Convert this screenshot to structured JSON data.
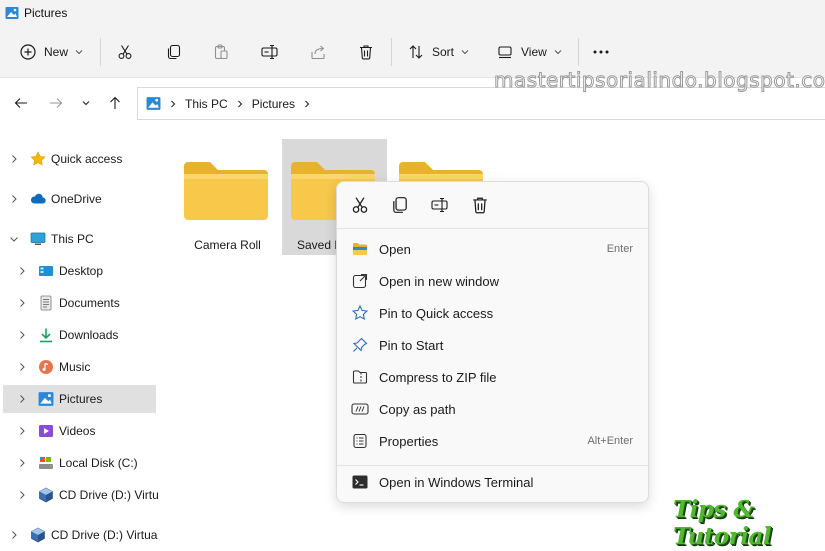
{
  "window": {
    "title": "Pictures",
    "icon": "pictures-icon"
  },
  "toolbar": {
    "new_label": "New",
    "sort_label": "Sort",
    "view_label": "View",
    "icons": [
      "new-icon",
      "cut-icon",
      "copy-icon",
      "paste-icon",
      "rename-icon",
      "share-icon",
      "delete-icon",
      "sort-icon",
      "view-icon",
      "more-icon"
    ]
  },
  "address": {
    "crumbs": [
      "This PC",
      "Pictures"
    ]
  },
  "watermark": "mastertipsorialindo.blogspot.com",
  "sidebar": {
    "items": [
      {
        "label": "Quick access",
        "icon": "star-icon",
        "expanded": false
      },
      {
        "label": "OneDrive",
        "icon": "cloud-icon",
        "expanded": false
      },
      {
        "label": "This PC",
        "icon": "monitor-icon",
        "expanded": true
      },
      {
        "label": "Desktop",
        "icon": "desktop-icon",
        "expanded": false
      },
      {
        "label": "Documents",
        "icon": "documents-icon",
        "expanded": false
      },
      {
        "label": "Downloads",
        "icon": "downloads-icon",
        "expanded": false
      },
      {
        "label": "Music",
        "icon": "music-icon",
        "expanded": false
      },
      {
        "label": "Pictures",
        "icon": "pictures-icon",
        "expanded": false,
        "selected": true
      },
      {
        "label": "Videos",
        "icon": "videos-icon",
        "expanded": false
      },
      {
        "label": "Local Disk (C:)",
        "icon": "drive-icon",
        "expanded": false
      },
      {
        "label": "CD Drive (D:) Virtu",
        "icon": "cd-drive-icon",
        "expanded": false
      },
      {
        "label": "CD Drive (D:) Virtual",
        "icon": "cd-drive-icon",
        "expanded": false
      }
    ]
  },
  "content": {
    "folders": [
      {
        "label": "Camera Roll",
        "selected": false
      },
      {
        "label": "Saved P",
        "selected": true
      },
      {
        "label": "",
        "selected": false
      }
    ]
  },
  "context_menu": {
    "quick_actions": [
      "cut-icon",
      "copy-icon",
      "rename-icon",
      "delete-icon"
    ],
    "items": [
      {
        "label": "Open",
        "shortcut": "Enter",
        "icon": "open-folder-icon"
      },
      {
        "label": "Open in new window",
        "shortcut": "",
        "icon": "new-window-icon"
      },
      {
        "label": "Pin to Quick access",
        "shortcut": "",
        "icon": "star-outline-icon"
      },
      {
        "label": "Pin to Start",
        "shortcut": "",
        "icon": "pin-icon"
      },
      {
        "label": "Compress to ZIP file",
        "shortcut": "",
        "icon": "zip-icon"
      },
      {
        "label": "Copy as path",
        "shortcut": "",
        "icon": "copy-path-icon"
      },
      {
        "label": "Properties",
        "shortcut": "Alt+Enter",
        "icon": "properties-icon"
      },
      {
        "label": "Open in Windows Terminal",
        "shortcut": "",
        "icon": "terminal-icon"
      }
    ]
  },
  "badge": "Tips & Tutorial",
  "colors": {
    "folder": "#f6c342",
    "folder_light": "#fbd66b",
    "accent": "#0067c0",
    "selected_bg": "#e0e0e0"
  }
}
